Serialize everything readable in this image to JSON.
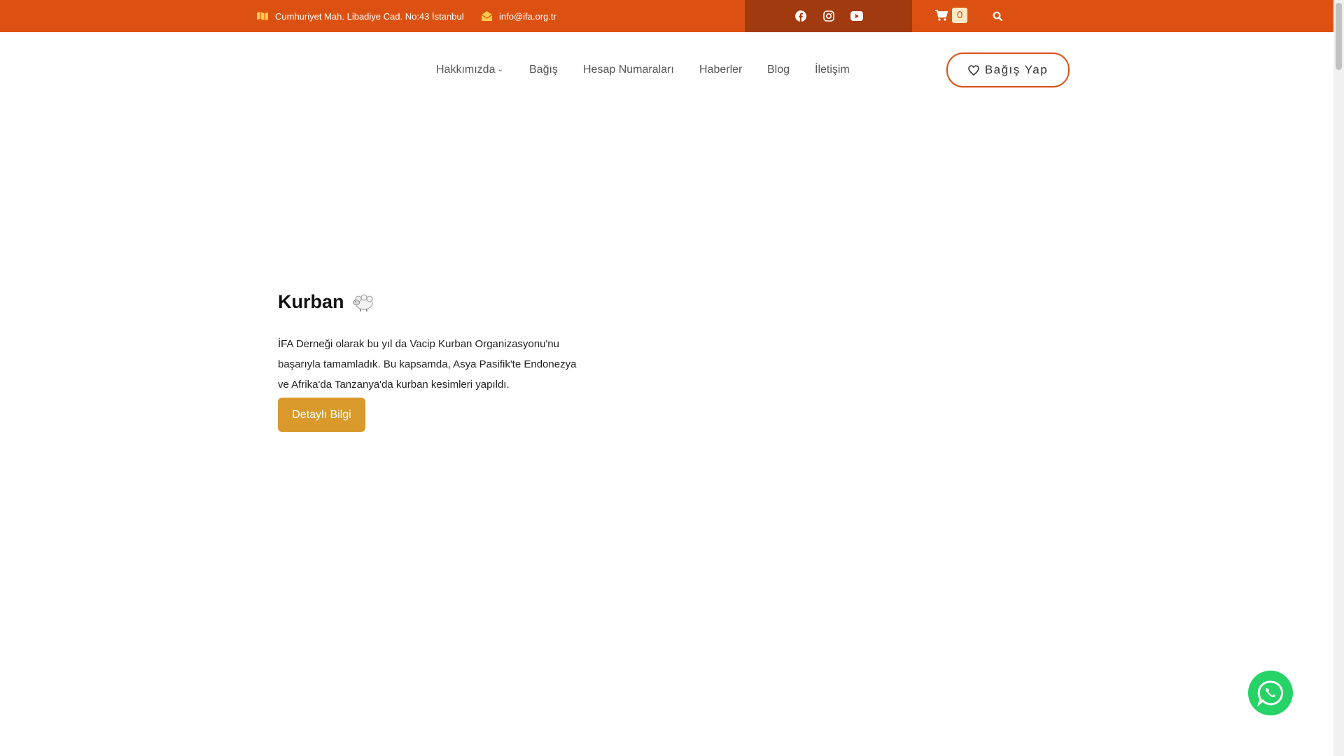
{
  "topbar": {
    "address": "Cumhuriyet Mah. Libadiye Cad. No:43 İstanbul",
    "email": "info@ifa.org.tr",
    "social": [
      "facebook-icon",
      "instagram-icon",
      "youtube-icon"
    ],
    "cart_count": "0"
  },
  "nav": {
    "items": [
      "Hakkımızda",
      "Bağış",
      "Hesap Numaraları",
      "Haberler",
      "Blog",
      "İletişim"
    ],
    "donate_label": "Bağış Yap"
  },
  "hero": {
    "title": "Kurban",
    "text": "İFA Derneği olarak bu yıl da Vacip Kurban Organizasyonu'nu başarıyla tamamladık. Bu kapsamda, Asya Pasifik'te Endonezya ve Afrika'da Tanzanya'da kurban kesimleri yapıldı.",
    "button_label": "Detaylı Bilgi"
  },
  "colors": {
    "topbar": "#dc5111",
    "social_box": "#a23a10",
    "accent_button": "#d99a2b",
    "whatsapp": "#25d366"
  }
}
